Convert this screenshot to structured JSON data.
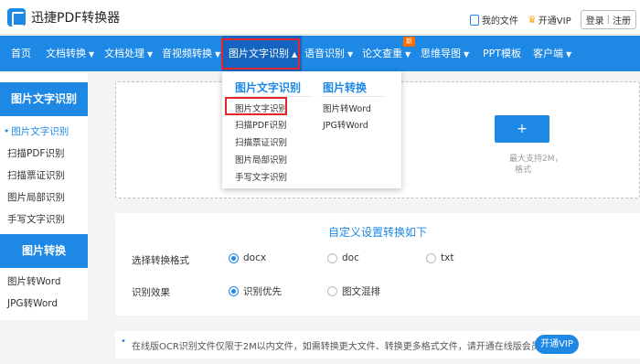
{
  "header": {
    "logo_text": "迅捷PDF转换器",
    "my_files": "我的文件",
    "open_vip": "开通VIP",
    "login": "登录",
    "separator": "|",
    "register": "注册"
  },
  "nav": {
    "items": [
      {
        "label": "首页",
        "caret": ""
      },
      {
        "label": "文档转换",
        "caret": "▼"
      },
      {
        "label": "文档处理",
        "caret": "▼"
      },
      {
        "label": "音视频转换",
        "caret": "▼"
      },
      {
        "label": "图片文字识别",
        "caret": "▲"
      },
      {
        "label": "语音识别",
        "caret": "▼"
      },
      {
        "label": "论文查重",
        "caret": "▼"
      },
      {
        "label": "思维导图",
        "caret": "▼"
      },
      {
        "label": "PPT模板",
        "caret": ""
      },
      {
        "label": "客户端",
        "caret": "▼"
      }
    ],
    "new_badge": "新"
  },
  "dropdown": {
    "col1_title": "图片文字识别",
    "col1_items": [
      "图片文字识别",
      "扫描PDF识别",
      "扫描票证识别",
      "图片局部识别",
      "手写文字识别"
    ],
    "col2_title": "图片转换",
    "col2_items": [
      "图片转Word",
      "JPG转Word"
    ]
  },
  "sidebar": {
    "section1_title": "图片文字识别",
    "section1_items": [
      "图片文字识别",
      "扫描PDF识别",
      "扫描票证识别",
      "图片局部识别",
      "手写文字识别"
    ],
    "section2_title": "图片转换",
    "section2_items": [
      "图片转Word",
      "JPG转Word"
    ]
  },
  "upload": {
    "button_symbol": "+",
    "hint_line1": "最大支持2M，",
    "hint_line2": "格式"
  },
  "settings": {
    "title": "自定义设置转换如下",
    "format_label": "选择转换格式",
    "format_options": [
      "docx",
      "doc",
      "txt"
    ],
    "format_selected": "docx",
    "effect_label": "识别效果",
    "effect_options": [
      "识别优先",
      "图文混排"
    ],
    "effect_selected": "识别优先"
  },
  "notice": {
    "bullet": "•",
    "text": "在线版OCR识别文件仅限于2M以内文件，如需转换更大文件、转换更多格式文件，请开通在线版会员。",
    "vip_button": "开通VIP"
  },
  "colors": {
    "primary": "#1e88e5",
    "highlight_red": "#e8242b",
    "badge_orange": "#ff6d00"
  }
}
